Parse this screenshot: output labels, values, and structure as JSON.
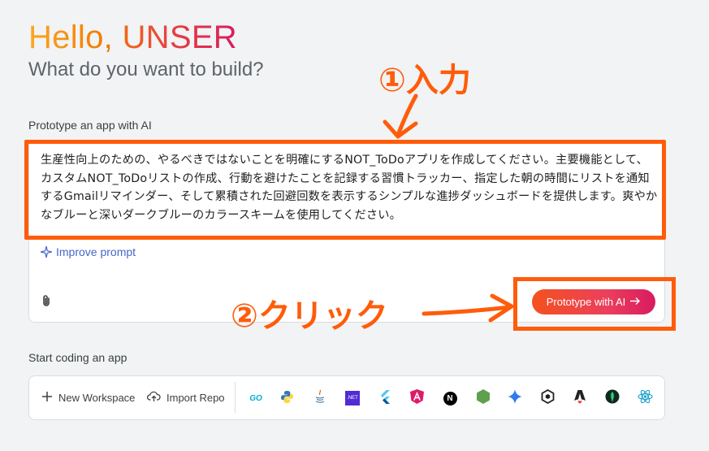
{
  "greeting": {
    "title": "Hello, UNSER",
    "subtitle": "What do you want to build?"
  },
  "prototype": {
    "label": "Prototype an app with AI",
    "prompt": "生産性向上のための、やるべきではないことを明確にするNOT_ToDoアプリを作成してください。主要機能として、カスタムNOT_ToDoリストの作成、行動を避けたことを記録する習慣トラッカー、指定した朝の時間にリストを通知するGmailリマインダー、そして累積された回避回数を表示するシンプルな進捗ダッシュボードを提供します。爽やかなブルーと深いダークブルーのカラースキームを使用してください。",
    "improve_label": "Improve prompt",
    "button_label": "Prototype with AI",
    "button_icon": "arrow-right-icon"
  },
  "annotations": {
    "step1": "①入力",
    "step2": "②クリック",
    "color": "#ff5c0a"
  },
  "start": {
    "label": "Start coding an app",
    "new_workspace": "New Workspace",
    "import_repo": "Import Repo",
    "templates": [
      {
        "name": "Go",
        "icon": "go-icon"
      },
      {
        "name": "Python",
        "icon": "python-icon"
      },
      {
        "name": "Java",
        "icon": "java-icon"
      },
      {
        "name": ".NET",
        "icon": "dotnet-icon"
      },
      {
        "name": "Flutter",
        "icon": "flutter-icon"
      },
      {
        "name": "Angular",
        "icon": "angular-icon"
      },
      {
        "name": "Next.js",
        "icon": "nextjs-icon"
      },
      {
        "name": "Node.js",
        "icon": "nodejs-icon"
      },
      {
        "name": "Gemini",
        "icon": "gemini-icon"
      },
      {
        "name": "Template",
        "icon": "hexagon-icon"
      },
      {
        "name": "Astro",
        "icon": "astro-icon"
      },
      {
        "name": "MongoDB",
        "icon": "mongodb-icon"
      },
      {
        "name": "React",
        "icon": "react-icon"
      }
    ],
    "dotnet_text": ".NET",
    "nextjs_text": "N",
    "go_text": "GO"
  }
}
